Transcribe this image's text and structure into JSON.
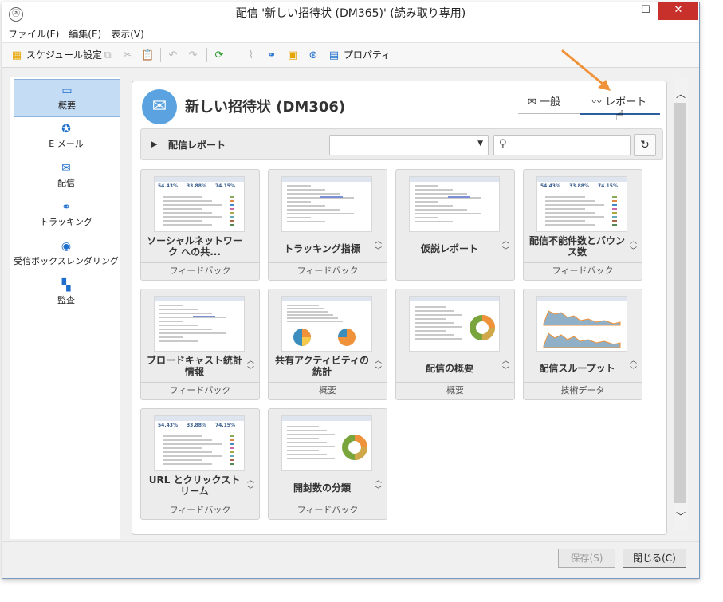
{
  "window": {
    "title": "配信 '新しい招待状 (DM365)' (読み取り専用)",
    "controls": {
      "minimize": "—",
      "maximize": "☐",
      "close": "✕"
    }
  },
  "menu": [
    "ファイル(F)",
    "編集(E)",
    "表示(V)"
  ],
  "toolbar": {
    "schedule_label": "スケジュール設定",
    "properties_label": "プロパティ"
  },
  "sidebar": {
    "items": [
      {
        "label": "概要",
        "icon": "overview-icon",
        "active": true
      },
      {
        "label": "E メール",
        "icon": "email-icon"
      },
      {
        "label": "配信",
        "icon": "delivery-icon"
      },
      {
        "label": "トラッキング",
        "icon": "tracking-icon"
      },
      {
        "label": "受信ボックスレンダリング",
        "icon": "globe-icon"
      },
      {
        "label": "監査",
        "icon": "audit-icon"
      }
    ]
  },
  "header": {
    "title": "新しい招待状 (DM306)",
    "tabs": {
      "general": "一般",
      "report": "レポート"
    },
    "active_tab": "report"
  },
  "report_bar": {
    "label": "配信レポート",
    "select_value": "",
    "search_value": ""
  },
  "cards": [
    {
      "title": "ソーシャルネットワーク への共...",
      "category": "フィードバック",
      "thumb": "kpi",
      "arrows": false
    },
    {
      "title": "トラッキング指標",
      "category": "フィードバック",
      "thumb": "table",
      "arrows": true
    },
    {
      "title": "仮説レポート",
      "category": "",
      "thumb": "table",
      "arrows": true
    },
    {
      "title": "配信不能件数とバウンス数",
      "category": "フィードバック",
      "thumb": "kpi",
      "arrows": true
    },
    {
      "title": "ブロードキャスト統計情報",
      "category": "フィードバック",
      "thumb": "table",
      "arrows": true
    },
    {
      "title": "共有アクティビティの統計",
      "category": "概要",
      "thumb": "pie",
      "arrows": true
    },
    {
      "title": "配信の概要",
      "category": "概要",
      "thumb": "donut",
      "arrows": true
    },
    {
      "title": "配信スループット",
      "category": "技術データ",
      "thumb": "area",
      "arrows": true
    },
    {
      "title": "URL とクリックストリーム",
      "category": "フィードバック",
      "thumb": "kpi",
      "arrows": true
    },
    {
      "title": "開封数の分類",
      "category": "フィードバック",
      "thumb": "donut",
      "arrows": true
    }
  ],
  "footer": {
    "save": "保存(S)",
    "close": "閉じる(C)"
  },
  "colors": {
    "accent": "#2c5f9e",
    "orange": "#f0923a",
    "close_red": "#c7302b",
    "active_side": "#c5dcf5"
  }
}
